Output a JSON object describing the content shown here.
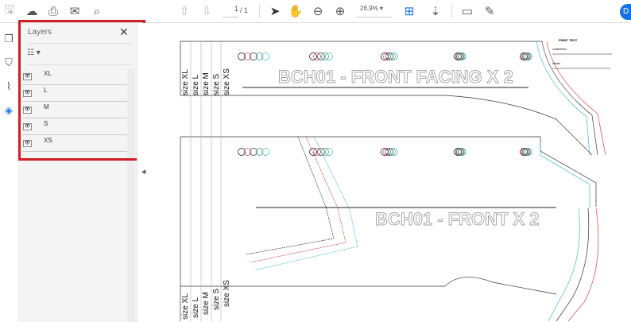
{
  "toolbar": {
    "icons": [
      "save-icon",
      "cloud-upload-icon",
      "print-icon",
      "email-icon",
      "search-zoom-icon",
      "page-up-icon",
      "page-down-icon",
      "select-arrow-icon",
      "hand-icon",
      "zoom-out-icon",
      "zoom-in-icon",
      "fit-page-icon",
      "scroll-mode-icon",
      "comment-icon",
      "sign-icon"
    ],
    "page_current": "1",
    "page_total": "/ 1",
    "zoom": "26,9%",
    "share_initial": "D",
    "accent": "#1473e6"
  },
  "rail": {
    "icons": [
      "pages-icon",
      "bookmark-icon",
      "attachment-icon",
      "layers-icon"
    ]
  },
  "panel": {
    "title": "Layers",
    "close": "✕",
    "highlight_color": "#d21f26",
    "layers": [
      {
        "name": "XL",
        "visible": true
      },
      {
        "name": "L",
        "visible": true
      },
      {
        "name": "M",
        "visible": true
      },
      {
        "name": "S",
        "visible": true
      },
      {
        "name": "XS",
        "visible": true
      }
    ]
  },
  "document": {
    "piece1_title": "BCH01 - FRONT FACING  X 2",
    "piece2_title": "BCH01 - FRONT X 2",
    "sizes": [
      "size XL",
      "size L",
      "size M",
      "size S",
      "size XS"
    ],
    "print_test": {
      "title": "PRINT TEST",
      "cm_label": "centimeters",
      "inch_label": "inches"
    },
    "size_colors": [
      "#000000",
      "#d04050",
      "#333333",
      "#3a9a7a",
      "#40b8c8"
    ]
  }
}
